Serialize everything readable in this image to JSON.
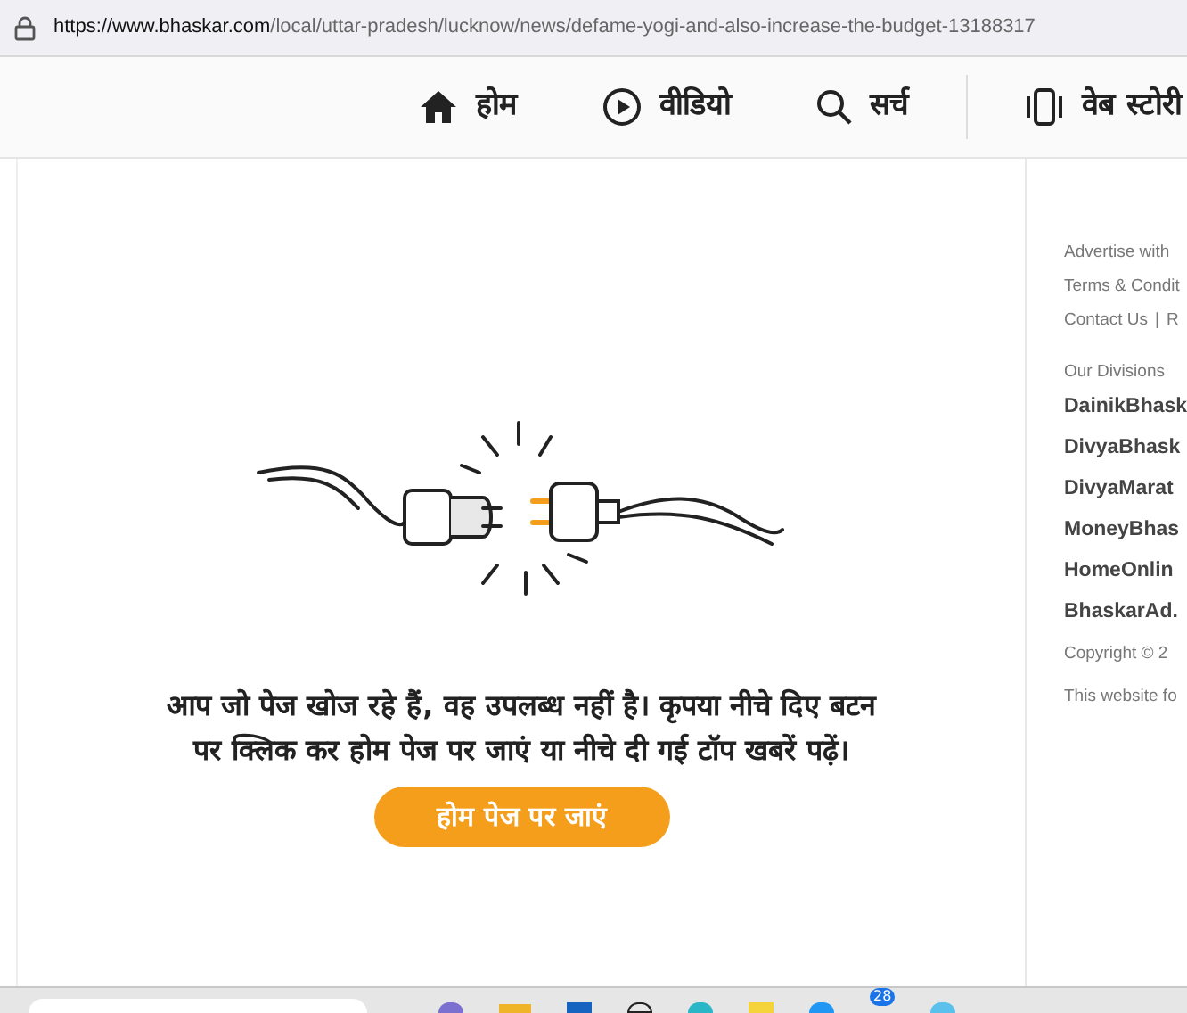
{
  "address_bar": {
    "url_host": "https://www.bhaskar.com",
    "url_path": "/local/uttar-pradesh/lucknow/news/defame-yogi-and-also-increase-the-budget-13188317"
  },
  "nav": [
    {
      "kind": "home",
      "label": "होम"
    },
    {
      "kind": "video",
      "label": "वीडियो"
    },
    {
      "kind": "search",
      "label": "सर्च"
    },
    {
      "kind": "stories",
      "label": "वेब स्टोरी"
    }
  ],
  "message": "आप जो पेज खोज रहे हैं, वह उपलब्ध नहीं है। कृपया नीचे दिए बटन पर क्लिक कर होम पेज पर जाएं या नीचे दी गई टॉप खबरें पढ़ें।",
  "home_button": "होम पेज पर जाएं",
  "sidebar": {
    "links": [
      "Advertise with",
      "Terms & Condit"
    ],
    "contact": "Contact Us",
    "separator": "|",
    "contact_next": "R",
    "divisions_title": "Our Divisions",
    "divisions": [
      "DainikBhask",
      "DivyaBhask",
      "DivyaMarat",
      "MoneyBhas",
      "HomeOnlin",
      "BhaskarAd."
    ],
    "copyright": "Copyright © 2",
    "notice": "This website fo"
  },
  "taskbar": {
    "badge": "28"
  }
}
